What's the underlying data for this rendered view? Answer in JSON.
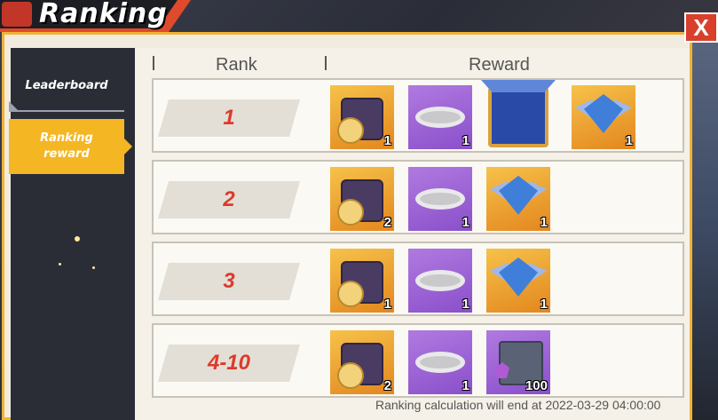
{
  "window": {
    "title": "Ranking",
    "close_label": "X"
  },
  "sidebar": {
    "items": [
      {
        "label": "Leaderboard",
        "active": false
      },
      {
        "label": "Ranking reward",
        "line1": "Ranking",
        "line2": "reward",
        "active": true
      }
    ]
  },
  "table": {
    "headers": {
      "rank": "Rank",
      "reward": "Reward"
    },
    "rows": [
      {
        "rank": "1",
        "rewards": [
          {
            "icon": "coin-suitcase-icon",
            "bg": "gold",
            "count": "1"
          },
          {
            "icon": "silver-ring-icon",
            "bg": "purple",
            "count": "1"
          },
          {
            "icon": "avatar-frame-icon",
            "bg": "frame",
            "count": ""
          },
          {
            "icon": "diamond-badge-icon",
            "bg": "gold",
            "count": "1"
          }
        ]
      },
      {
        "rank": "2",
        "rewards": [
          {
            "icon": "coin-suitcase-icon",
            "bg": "gold",
            "count": "2"
          },
          {
            "icon": "silver-ring-icon",
            "bg": "purple",
            "count": "1"
          },
          {
            "icon": "diamond-badge-icon",
            "bg": "gold",
            "count": "1"
          }
        ]
      },
      {
        "rank": "3",
        "rewards": [
          {
            "icon": "coin-suitcase-icon",
            "bg": "gold",
            "count": "1"
          },
          {
            "icon": "silver-ring-icon",
            "bg": "purple",
            "count": "1"
          },
          {
            "icon": "diamond-badge-icon",
            "bg": "gold",
            "count": "1"
          }
        ]
      },
      {
        "rank": "4-10",
        "rewards": [
          {
            "icon": "coin-suitcase-icon",
            "bg": "gold",
            "count": "2"
          },
          {
            "icon": "silver-ring-icon",
            "bg": "purple",
            "count": "1"
          },
          {
            "icon": "gem-chest-icon",
            "bg": "purple",
            "count": "100"
          }
        ]
      }
    ]
  },
  "footer": {
    "text": "Ranking calculation will end at 2022-03-29 04:00:00"
  },
  "colors": {
    "accent": "#f5b624",
    "rank_text": "#dc3b2b",
    "close": "#d8402c"
  }
}
